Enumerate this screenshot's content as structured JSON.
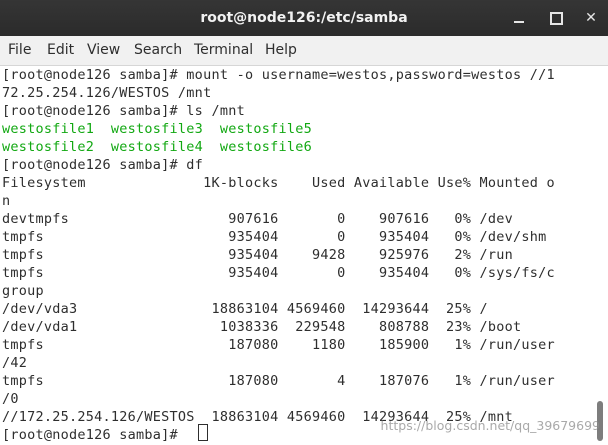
{
  "window": {
    "title": "root@node126:/etc/samba",
    "minimize_glyph": "",
    "close_glyph": "✕"
  },
  "menu": {
    "items": [
      "File",
      "Edit",
      "View",
      "Search",
      "Terminal",
      "Help"
    ]
  },
  "terminal": {
    "lines": [
      {
        "text": "[root@node126 samba]# mount -o username=westos,password=westos //1",
        "color": "default"
      },
      {
        "text": "72.25.254.126/WESTOS /mnt",
        "color": "default"
      },
      {
        "text": "[root@node126 samba]# ls /mnt",
        "color": "default"
      },
      {
        "text": "westosfile1  westosfile3  westosfile5",
        "color": "green"
      },
      {
        "text": "westosfile2  westosfile4  westosfile6",
        "color": "green"
      },
      {
        "text": "[root@node126 samba]# df",
        "color": "default"
      },
      {
        "text": "Filesystem              1K-blocks    Used Available Use% Mounted o",
        "color": "default"
      },
      {
        "text": "n",
        "color": "default"
      },
      {
        "text": "devtmpfs                   907616       0    907616   0% /dev",
        "color": "default"
      },
      {
        "text": "tmpfs                      935404       0    935404   0% /dev/shm",
        "color": "default"
      },
      {
        "text": "tmpfs                      935404    9428    925976   2% /run",
        "color": "default"
      },
      {
        "text": "tmpfs                      935404       0    935404   0% /sys/fs/c",
        "color": "default"
      },
      {
        "text": "group",
        "color": "default"
      },
      {
        "text": "/dev/vda3                18863104 4569460  14293644  25% /",
        "color": "default"
      },
      {
        "text": "/dev/vda1                 1038336  229548    808788  23% /boot",
        "color": "default"
      },
      {
        "text": "tmpfs                      187080    1180    185900   1% /run/user",
        "color": "default"
      },
      {
        "text": "/42",
        "color": "default"
      },
      {
        "text": "tmpfs                      187080       4    187076   1% /run/user",
        "color": "default"
      },
      {
        "text": "/0",
        "color": "default"
      },
      {
        "text": "//172.25.254.126/WESTOS  18863104 4569460  14293644  25% /mnt",
        "color": "default"
      },
      {
        "text": "[root@node126 samba]# ",
        "color": "default"
      }
    ],
    "colors": {
      "default": "#2e2e2e",
      "green": "#12a812"
    }
  },
  "watermark": "https://blog.csdn.net/qq_39679699"
}
